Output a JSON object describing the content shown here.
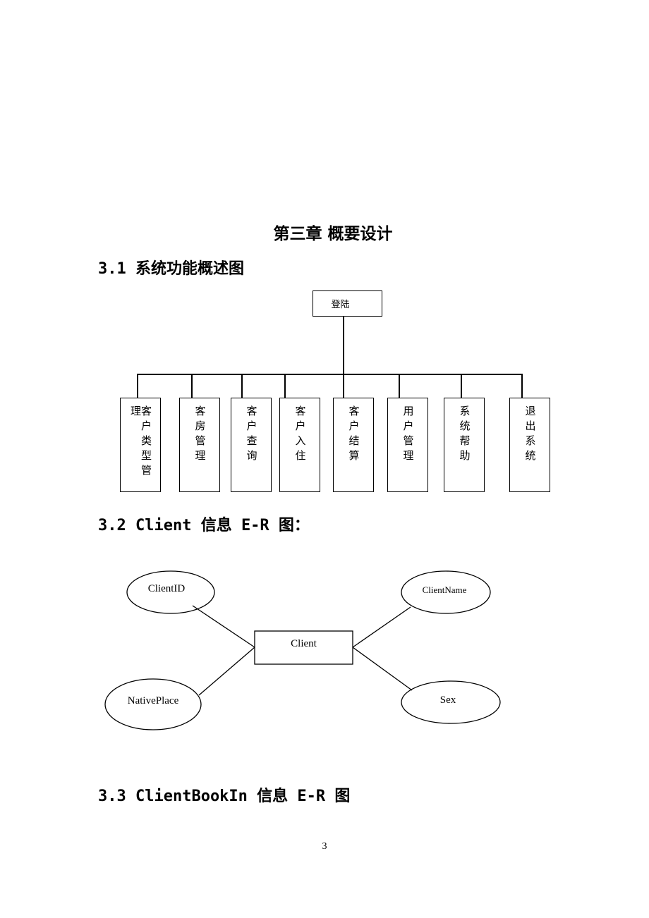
{
  "chapter_title": "第三章  概要设计",
  "sections": {
    "s31": "3.1 系统功能概述图",
    "s32": "3.2 Client 信息 E-R 图：",
    "s33": "3.3 ClientBookIn 信息 E-R 图"
  },
  "function_diagram": {
    "root": "登陆",
    "children": [
      "客户类型管理",
      "客房管理",
      "客户查询",
      "客户入住",
      "客户结算",
      "用户管理",
      "系统帮助",
      "退出系统"
    ]
  },
  "er_client": {
    "entity": "Client",
    "attributes": [
      "ClientID",
      "ClientName",
      "NativePlace",
      "Sex"
    ]
  },
  "page_number": "3"
}
